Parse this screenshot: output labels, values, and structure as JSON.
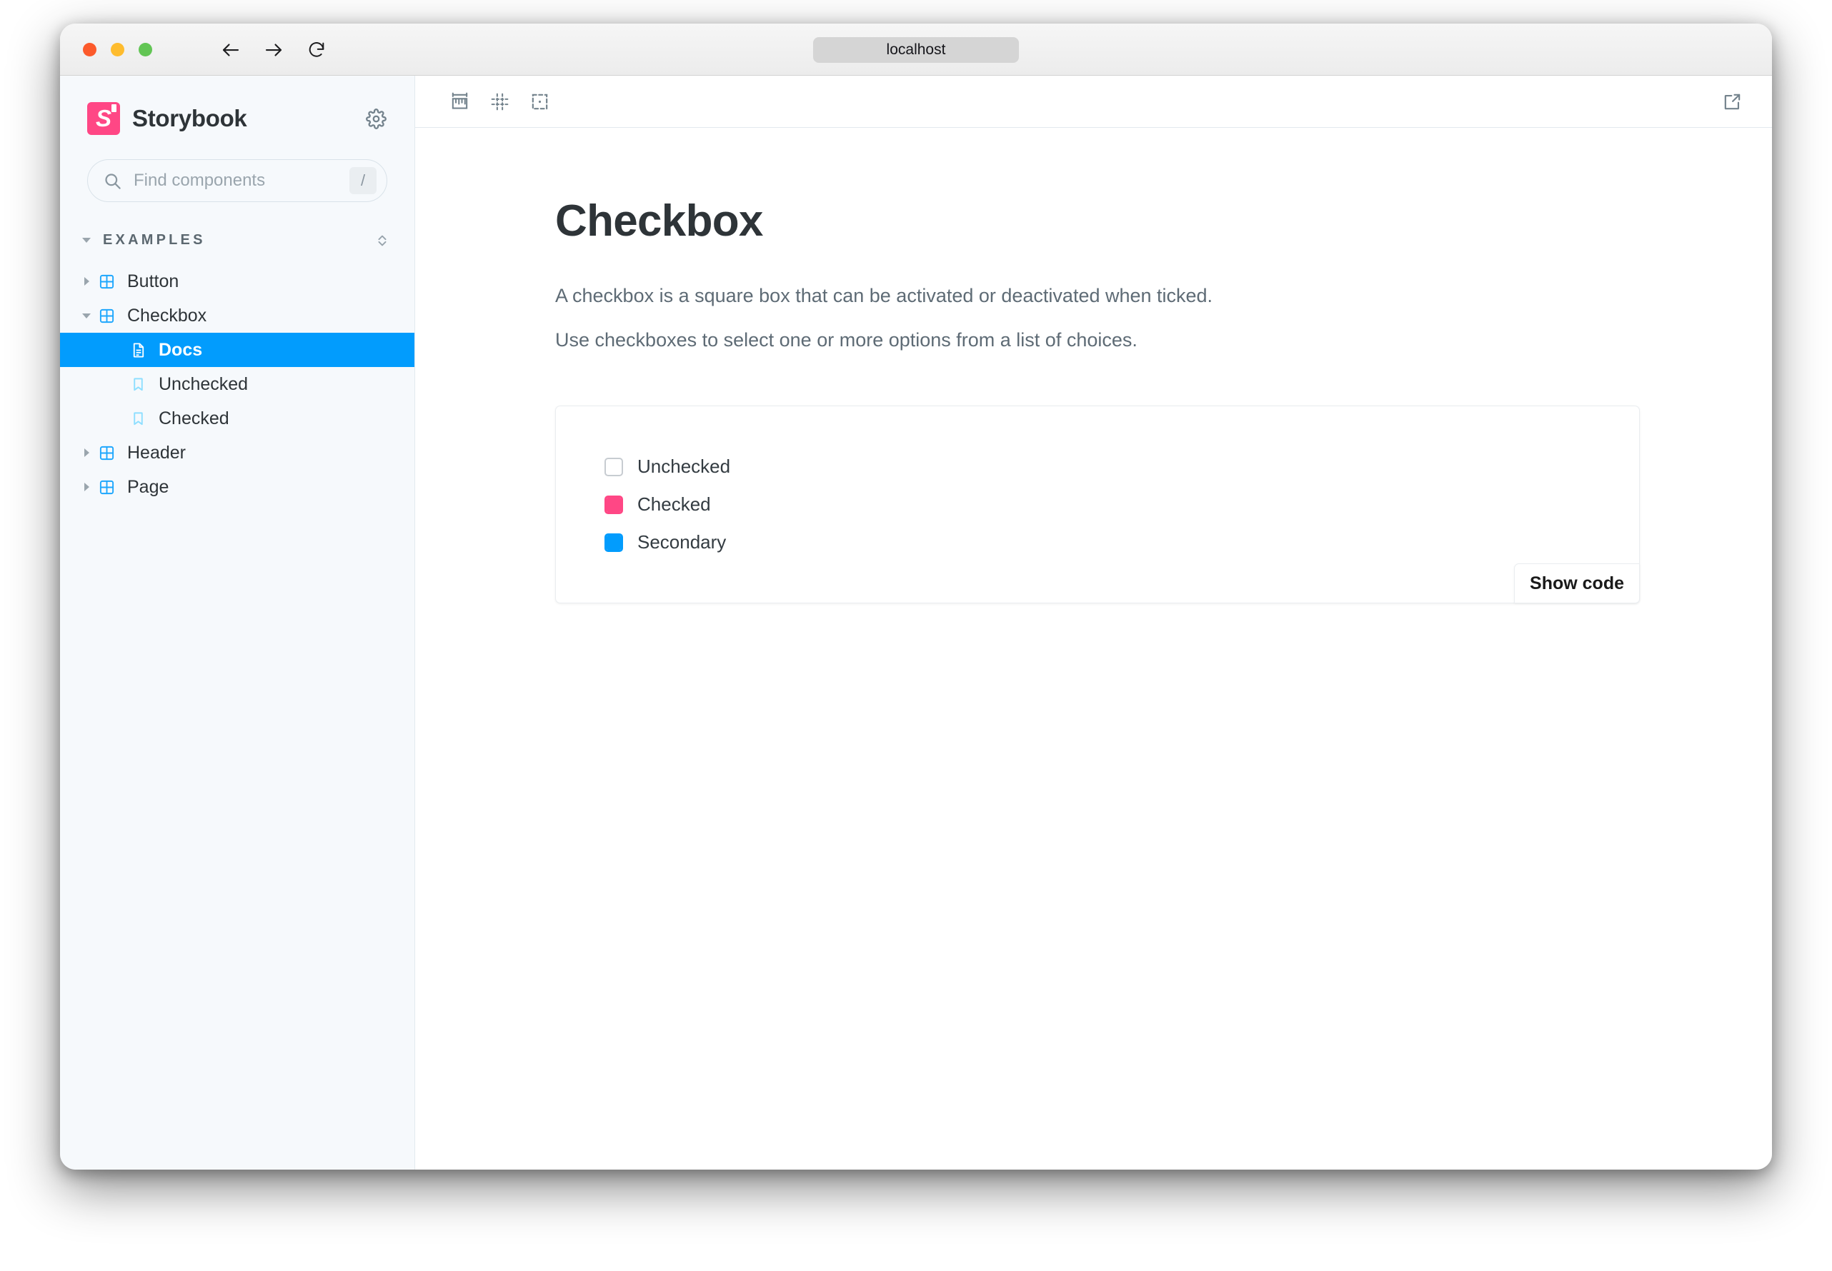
{
  "browser": {
    "url": "localhost",
    "back_label": "Back",
    "forward_label": "Forward",
    "reload_label": "Reload"
  },
  "sidebar": {
    "brand": "Storybook",
    "search": {
      "placeholder": "Find components",
      "shortcut": "/"
    },
    "group": {
      "label": "EXAMPLES"
    },
    "items": [
      {
        "label": "Button",
        "depth": 1,
        "icon": "component-icon",
        "expanded": false,
        "selected": false
      },
      {
        "label": "Checkbox",
        "depth": 1,
        "icon": "component-icon",
        "expanded": true,
        "selected": false
      },
      {
        "label": "Docs",
        "depth": 2,
        "icon": "document-icon",
        "expanded": null,
        "selected": true
      },
      {
        "label": "Unchecked",
        "depth": 2,
        "icon": "story-icon",
        "expanded": null,
        "selected": false
      },
      {
        "label": "Checked",
        "depth": 2,
        "icon": "story-icon",
        "expanded": null,
        "selected": false
      },
      {
        "label": "Header",
        "depth": 1,
        "icon": "component-icon",
        "expanded": false,
        "selected": false
      },
      {
        "label": "Page",
        "depth": 1,
        "icon": "component-icon",
        "expanded": false,
        "selected": false
      }
    ]
  },
  "toolbar": {
    "measure_label": "Measure",
    "grid_label": "Grid",
    "outline_label": "Outline",
    "open_new_tab_label": "Open canvas in new tab"
  },
  "main": {
    "title": "Checkbox",
    "description_line1": "A checkbox is a square box that can be activated or deactivated when ticked.",
    "description_line2": "Use checkboxes to select one or more options from a list of choices.",
    "preview": {
      "checkboxes": [
        {
          "label": "Unchecked",
          "state": "unchecked",
          "color": "#c7ccd1"
        },
        {
          "label": "Checked",
          "state": "checked",
          "color": "#ff4785"
        },
        {
          "label": "Secondary",
          "state": "checked",
          "color": "#029cfd"
        }
      ],
      "show_code_label": "Show code"
    }
  },
  "colors": {
    "brand_pink": "#ff4785",
    "accent_blue": "#029cfd",
    "component_icon_blue": "#1ea7fd",
    "story_icon_blue": "#8fdfff",
    "sidebar_bg": "#f6f9fc"
  }
}
